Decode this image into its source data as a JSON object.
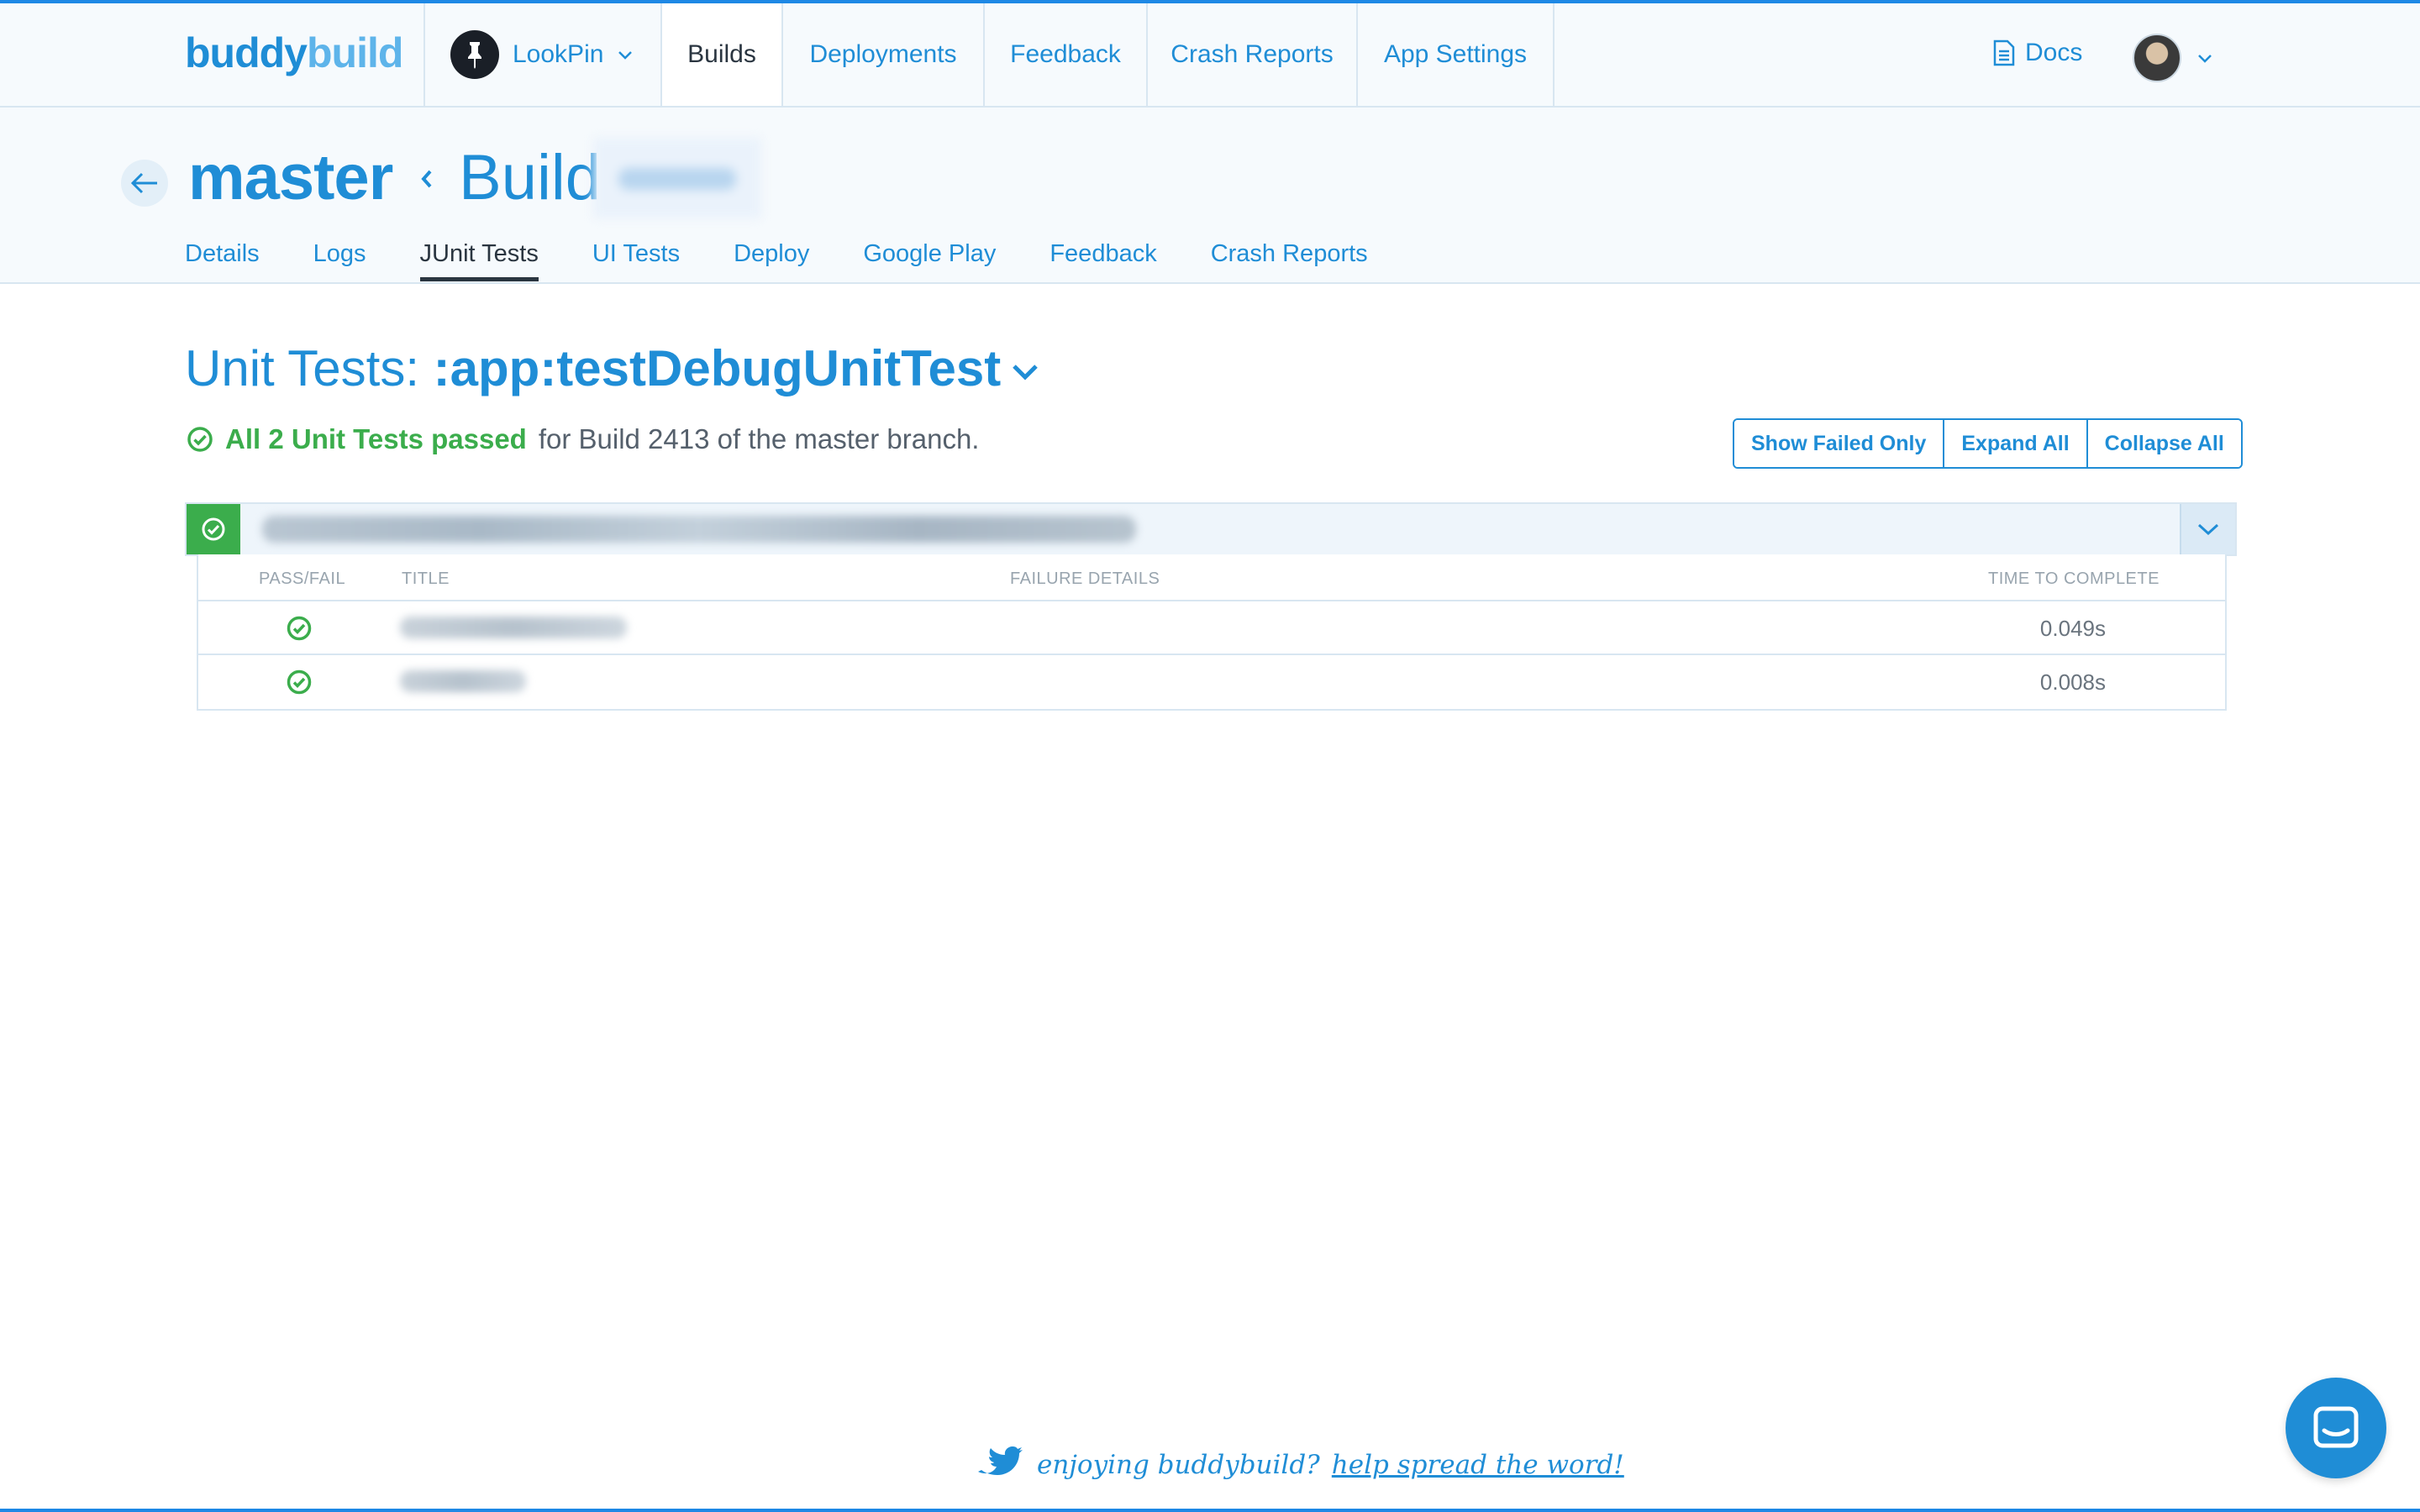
{
  "brand": {
    "part1": "buddy",
    "part2": "build"
  },
  "topnav": {
    "app_name": "LookPin",
    "tabs": [
      {
        "label": "Builds",
        "active": true
      },
      {
        "label": "Deployments"
      },
      {
        "label": "Feedback"
      },
      {
        "label": "Crash Reports"
      },
      {
        "label": "App Settings"
      }
    ],
    "docs_label": "Docs"
  },
  "header": {
    "branch": "master",
    "build_label": "Build",
    "subtabs": [
      {
        "label": "Details"
      },
      {
        "label": "Logs"
      },
      {
        "label": "JUnit Tests",
        "active": true
      },
      {
        "label": "UI Tests"
      },
      {
        "label": "Deploy"
      },
      {
        "label": "Google Play"
      },
      {
        "label": "Feedback"
      },
      {
        "label": "Crash Reports"
      }
    ]
  },
  "main": {
    "title_prefix": "Unit Tests:",
    "title_target": ":app:testDebugUnitTest",
    "summary_pass": "All 2 Unit Tests passed",
    "summary_rest": "for Build 2413 of the master branch.",
    "buttons": [
      "Show Failed Only",
      "Expand All",
      "Collapse All"
    ],
    "table": {
      "headers": [
        "PASS/FAIL",
        "TITLE",
        "FAILURE DETAILS",
        "TIME TO COMPLETE"
      ],
      "rows": [
        {
          "status": "pass",
          "time": "0.049s"
        },
        {
          "status": "pass",
          "time": "0.008s"
        }
      ]
    }
  },
  "footer": {
    "enjoying": "enjoying buddybuild?",
    "share": "help spread the word!"
  },
  "colors": {
    "accent": "#1f8dd6",
    "success": "#3bad4c",
    "text_dark": "#2a3540",
    "muted": "#98a4ae"
  }
}
